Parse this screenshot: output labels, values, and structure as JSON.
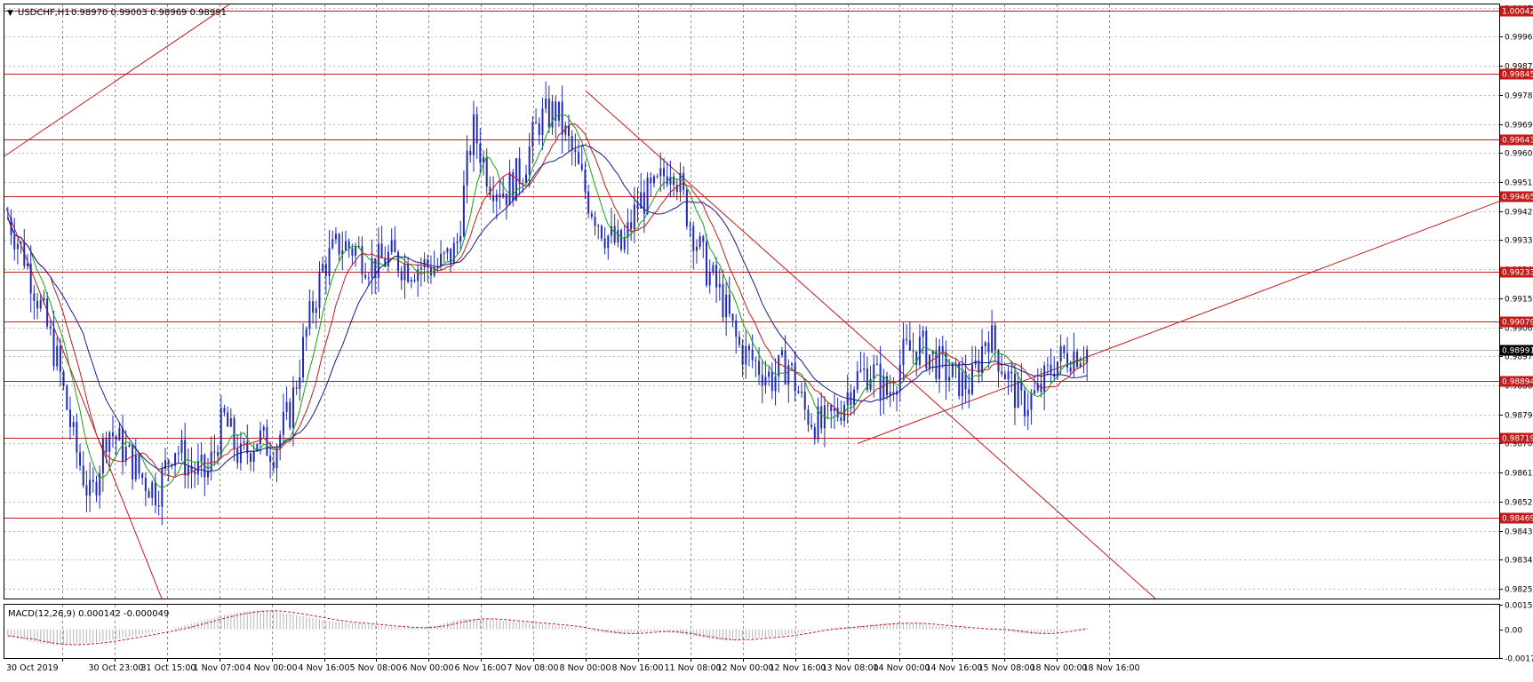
{
  "window": {
    "symbol_label": "USDCHF,H1",
    "ohlc_label": "0.98970 0.99003 0.98969 0.98991",
    "macd_label": "MACD(12,26,9) 0.000142 -0.000049"
  },
  "colors": {
    "background": "#ffffff",
    "candle": "#1f2ab8",
    "ma_fast": "#16a316",
    "ma_mid": "#c21b1b",
    "ma_slow": "#1a1a8c",
    "level_line": "#c21b1b",
    "trend_line": "#c21b1b",
    "macd_hist": "#b4b4b4",
    "macd_signal": "#c21b1b",
    "price_marker": "#000000",
    "grid": "#000000"
  },
  "chart_data": [
    {
      "type": "candlestick",
      "name": "USDCHF,H1",
      "ylim": [
        0.9822,
        1.0006
      ],
      "y_ticks": [
        "1.00050",
        "0.99960",
        "0.99870",
        "0.99780",
        "0.99690",
        "0.99600",
        "0.99510",
        "0.99420",
        "0.99330",
        "0.99240",
        "0.99150",
        "0.99060",
        "0.98970",
        "0.98880",
        "0.98790",
        "0.98700",
        "0.98610",
        "0.98520",
        "0.98430",
        "0.98340",
        "0.98250"
      ],
      "x_ticks": [
        "30 Oct 2019",
        "30 Oct 23:00",
        "31 Oct 15:00",
        "1 Nov 07:00",
        "4 Nov 00:00",
        "4 Nov 16:00",
        "5 Nov 08:00",
        "6 Nov 00:00",
        "6 Nov 16:00",
        "7 Nov 08:00",
        "8 Nov 00:00",
        "8 Nov 16:00",
        "11 Nov 08:00",
        "12 Nov 00:00",
        "12 Nov 16:00",
        "13 Nov 08:00",
        "14 Nov 00:00",
        "14 Nov 16:00",
        "15 Nov 08:00",
        "18 Nov 00:00",
        "18 Nov 16:00"
      ],
      "grid": true,
      "current_price": "0.98991",
      "levels": [
        "1.00042",
        "0.99845",
        "0.99643",
        "0.99465",
        "0.99233",
        "0.99079",
        "0.98894",
        "0.98719",
        "0.98469"
      ],
      "price_path": [
        0.994,
        0.9928,
        0.9912,
        0.9895,
        0.987,
        0.9852,
        0.9875,
        0.9868,
        0.986,
        0.9855,
        0.987,
        0.9862,
        0.986,
        0.9878,
        0.9865,
        0.9872,
        0.9868,
        0.988,
        0.9905,
        0.9925,
        0.9932,
        0.993,
        0.9925,
        0.9928,
        0.9925,
        0.9925,
        0.9925,
        0.993,
        0.9968,
        0.9952,
        0.9948,
        0.9955,
        0.997,
        0.9973,
        0.996,
        0.9945,
        0.9935,
        0.993,
        0.9945,
        0.9948,
        0.9958,
        0.994,
        0.9925,
        0.9915,
        0.99,
        0.9895,
        0.989,
        0.9895,
        0.988,
        0.9875,
        0.988,
        0.989,
        0.9893,
        0.9885,
        0.9898,
        0.99,
        0.9895,
        0.989,
        0.9888,
        0.9905,
        0.9893,
        0.9882,
        0.9885,
        0.9895,
        0.9898,
        0.9899
      ],
      "trend_lines": "present"
    },
    {
      "type": "bar",
      "name": "MACD(12,26,9)",
      "ylim": [
        -0.00179,
        0.00154
      ],
      "y_ticks": [
        "0.001549",
        "0.00",
        "-0.00179"
      ],
      "main": 0.000142,
      "signal": -4.9e-05,
      "histogram_path": [
        -0.0004,
        -0.0007,
        -0.0009,
        -0.001,
        -0.0009,
        -0.0008,
        -0.0006,
        -0.0004,
        -0.0002,
        0.0,
        0.0003,
        0.0006,
        0.0009,
        0.0011,
        0.0012,
        0.0011,
        0.0009,
        0.0007,
        0.0005,
        0.0004,
        0.0003,
        0.0002,
        0.0001,
        0.0001,
        0.0003,
        0.0006,
        0.0007,
        0.0006,
        0.0005,
        0.0004,
        0.0003,
        0.0002,
        0.0,
        -0.0002,
        -0.0003,
        -0.0002,
        -0.0001,
        -0.0002,
        -0.0004,
        -0.0006,
        -0.0007,
        -0.0006,
        -0.0005,
        -0.0004,
        -0.0002,
        0.0,
        0.0001,
        0.0002,
        0.0003,
        0.0004,
        0.0004,
        0.0003,
        0.0002,
        0.0001,
        0.0,
        0.0,
        -0.0002,
        -0.0003,
        -0.0002,
        0.0,
        0.0001
      ]
    }
  ]
}
